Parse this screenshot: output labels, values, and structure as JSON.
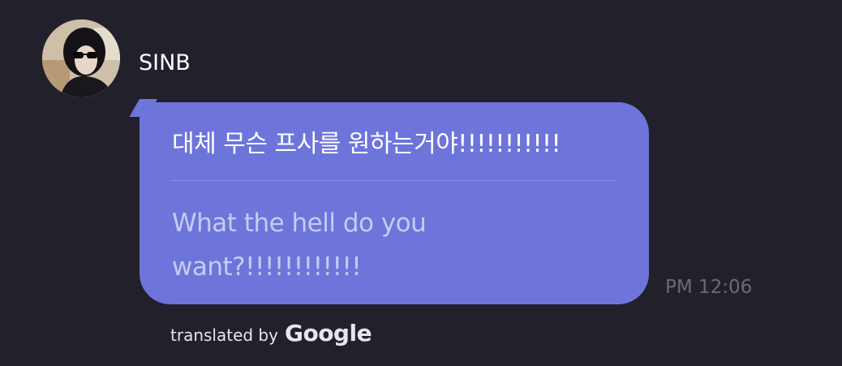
{
  "sender": {
    "name": "SINB"
  },
  "message": {
    "original": "대체 무슨 프사를 원하는거야!!!!!!!!!!!",
    "translation": "What the hell do you want?!!!!!!!!!!!!",
    "time": "PM 12:06"
  },
  "translation_credit": {
    "prefix": "translated by",
    "provider": "Google"
  },
  "colors": {
    "background": "#22212b",
    "bubble": "#6d75db",
    "translation_text": "#c7cbf3",
    "timestamp": "#6b6a72"
  }
}
